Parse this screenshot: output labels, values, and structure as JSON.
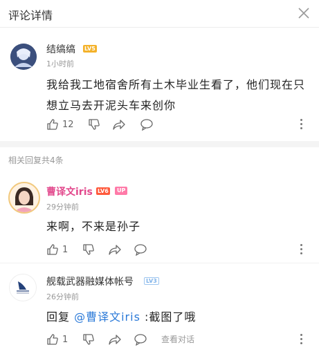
{
  "header": {
    "title": "评论详情",
    "close_icon": "close-icon"
  },
  "main_comment": {
    "author": "结缟缟",
    "level": "LV5",
    "time": "1小时前",
    "text_line1": "我给我工地宿舍所有土木毕业生看了，他们现在只",
    "text_line2": "想立马去开泥头车来创你",
    "likes": "12"
  },
  "replies_header": "相关回复共4条",
  "replies": [
    {
      "author": "曹译文iris",
      "level": "LV6",
      "badge": "UP",
      "time": "29分钟前",
      "text": "来啊，不来是孙子",
      "likes": "1"
    },
    {
      "author": "舰载武器融媒体帐号",
      "level": "LV3",
      "time": "26分钟前",
      "reply_prefix": "回复 ",
      "mention": "@曹译文iris",
      "text": " :截图了哦",
      "likes": "1",
      "view_conversation": "查看对话"
    }
  ],
  "colors": {
    "accent_pink": "#e2488c",
    "mention_blue": "#2a79d8",
    "lv5": "#f4b22a",
    "lv6": "#ff5a3c"
  }
}
